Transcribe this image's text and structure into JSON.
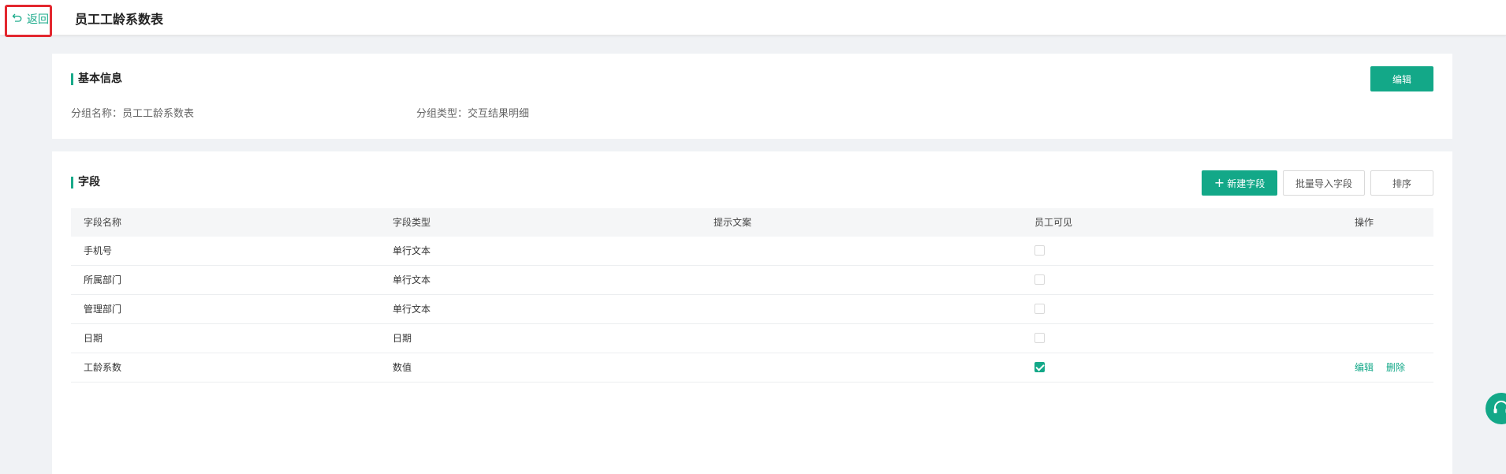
{
  "header": {
    "back_label": "返回",
    "title": "员工工龄系数表"
  },
  "basic_info": {
    "section_title": "基本信息",
    "edit_label": "编辑",
    "group_name_label": "分组名称：",
    "group_name_value": "员工工龄系数表",
    "group_type_label": "分组类型：",
    "group_type_value": "交互结果明细"
  },
  "fields": {
    "section_title": "字段",
    "new_field_label": "新建字段",
    "batch_import_label": "批量导入字段",
    "sort_label": "排序",
    "columns": [
      "字段名称",
      "字段类型",
      "提示文案",
      "员工可见",
      "操作"
    ],
    "rows": [
      {
        "name": "手机号",
        "type": "单行文本",
        "hint": "",
        "visible": false,
        "ops": []
      },
      {
        "name": "所属部门",
        "type": "单行文本",
        "hint": "",
        "visible": false,
        "ops": []
      },
      {
        "name": "管理部门",
        "type": "单行文本",
        "hint": "",
        "visible": false,
        "ops": []
      },
      {
        "name": "日期",
        "type": "日期",
        "hint": "",
        "visible": false,
        "ops": []
      },
      {
        "name": "工龄系数",
        "type": "数值",
        "hint": "",
        "visible": true,
        "ops": [
          "编辑",
          "删除"
        ]
      }
    ]
  },
  "icons": {
    "back": "undo-arrow-icon",
    "plus": "plus-icon",
    "support": "headset-icon"
  },
  "colors": {
    "accent": "#13a888",
    "highlight": "#e3272f"
  }
}
